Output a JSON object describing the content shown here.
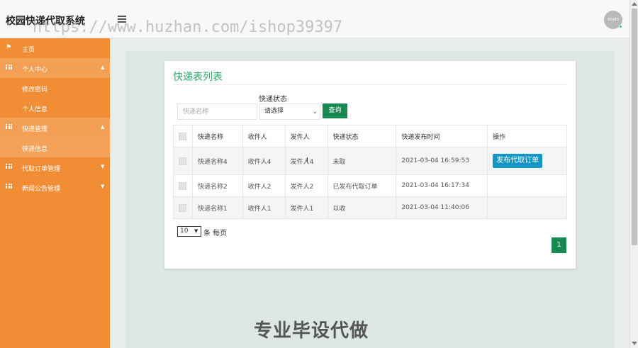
{
  "header": {
    "brand": "校园快递代取系统",
    "watermark": "https://www.huzhan.com/ishop39397",
    "avatar_text": "80x80"
  },
  "sidebar": {
    "items": [
      {
        "label": "主页",
        "icon": "flag-icon"
      },
      {
        "label": "个人中心",
        "icon": "grid-icon",
        "arrow": "▲"
      },
      {
        "label": "修改密码"
      },
      {
        "label": "个人信息"
      },
      {
        "label": "快递管理",
        "icon": "grid-icon",
        "arrow": "▲"
      },
      {
        "label": "快递信息"
      },
      {
        "label": "代取订单管理",
        "icon": "grid-icon",
        "arrow": "▼"
      },
      {
        "label": "新闻公告管理",
        "icon": "grid-icon",
        "arrow": "▼"
      }
    ]
  },
  "main": {
    "title": "快递表列表",
    "filter": {
      "status_label": "快递状态",
      "name_placeholder": "快递名称",
      "status_value": "请选择",
      "query_label": "查询"
    },
    "table": {
      "headers": [
        "快递名称",
        "收件人",
        "发件人",
        "快递状态",
        "快递发布时间",
        "操作"
      ],
      "rows": [
        {
          "name": "快递名称4",
          "recipient": "收件人4",
          "sender": "发件人4",
          "status": "未取",
          "time": "2021-03-04 16:59:53",
          "action": "发布代取订单"
        },
        {
          "name": "快递名称2",
          "recipient": "收件人2",
          "sender": "发件人2",
          "status": "已发布代取订单",
          "time": "2021-03-04 16:17:34",
          "action": ""
        },
        {
          "name": "快递名称1",
          "recipient": "收件人1",
          "sender": "发件人1",
          "status": "以收",
          "time": "2021-03-04 11:40:06",
          "action": ""
        }
      ]
    },
    "pagination": {
      "page_size": "10",
      "per_page_label": "条 每页",
      "current_page": "1"
    }
  },
  "footer_watermark": "专业毕设代做",
  "colors": {
    "sidebar": "#f08d35",
    "accent_green": "#178a53",
    "title_green": "#2eaa6e",
    "action_blue": "#1497c4"
  }
}
